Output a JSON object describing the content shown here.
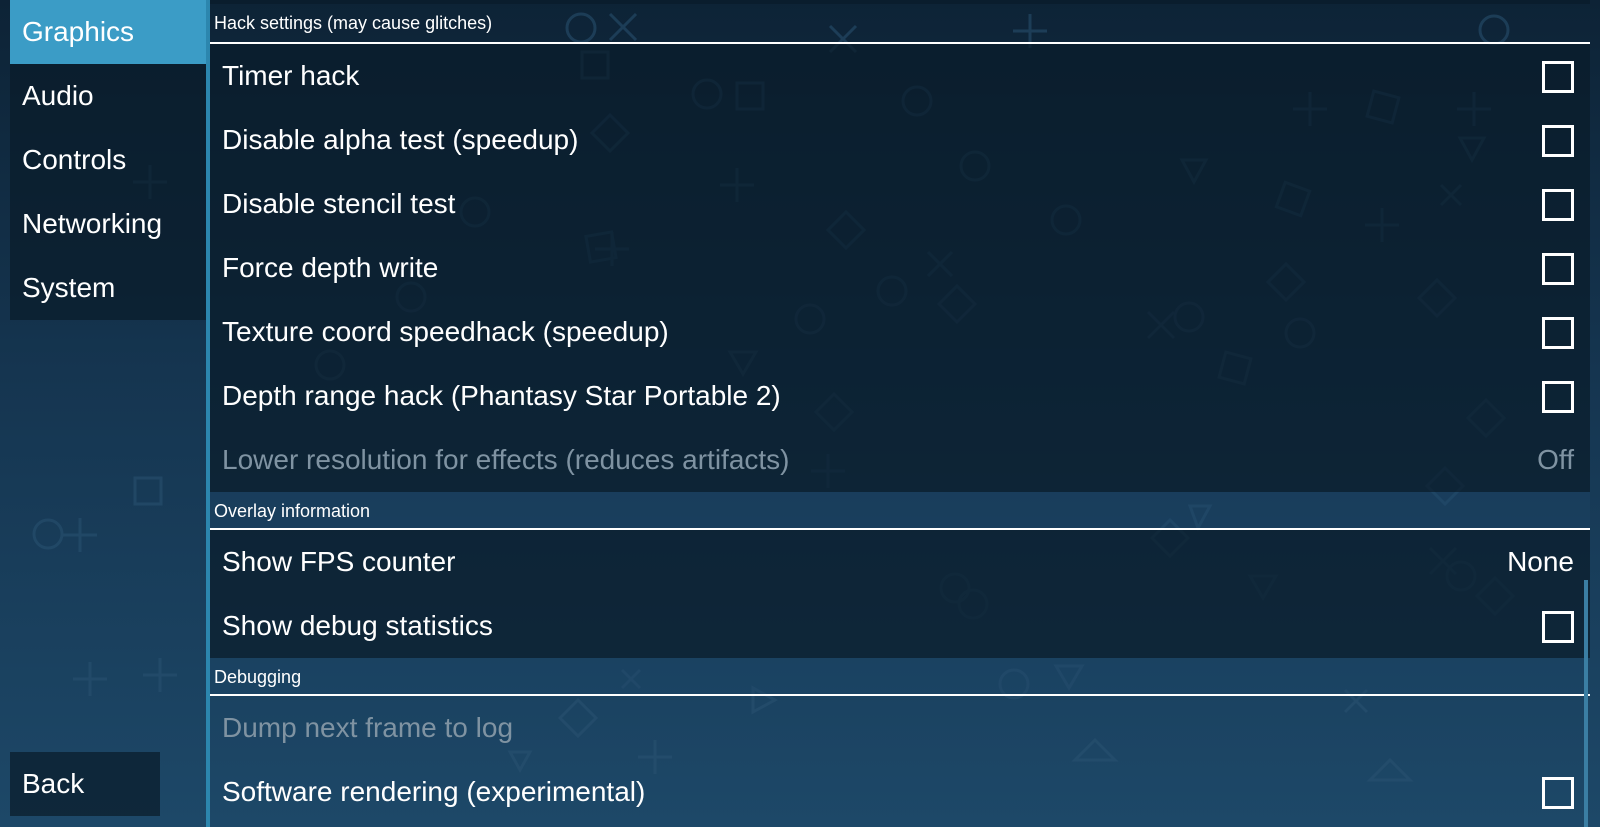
{
  "sidebar": {
    "tabs": [
      {
        "label": "Graphics",
        "active": true
      },
      {
        "label": "Audio",
        "active": false
      },
      {
        "label": "Controls",
        "active": false
      },
      {
        "label": "Networking",
        "active": false
      },
      {
        "label": "System",
        "active": false
      }
    ],
    "back_label": "Back"
  },
  "sections": {
    "hacks": {
      "title": "Hack settings (may cause glitches)",
      "items": [
        {
          "label": "Timer hack",
          "checked": false
        },
        {
          "label": "Disable alpha test (speedup)",
          "checked": false
        },
        {
          "label": "Disable stencil test",
          "checked": false
        },
        {
          "label": "Force depth write",
          "checked": false
        },
        {
          "label": "Texture coord speedhack (speedup)",
          "checked": false
        },
        {
          "label": "Depth range hack (Phantasy Star Portable 2)",
          "checked": false
        },
        {
          "label": "Lower resolution for effects (reduces artifacts)",
          "value": "Off",
          "disabled": true
        }
      ]
    },
    "overlay": {
      "title": "Overlay information",
      "items": [
        {
          "label": "Show FPS counter",
          "value": "None"
        },
        {
          "label": "Show debug statistics",
          "checked": false
        }
      ]
    },
    "debugging": {
      "title": "Debugging",
      "items": [
        {
          "label": "Dump next frame to log",
          "disabled": true
        },
        {
          "label": "Software rendering (experimental)",
          "checked": false
        }
      ]
    }
  },
  "colors": {
    "accent": "#3b9cc6",
    "background_top": "#0d2336",
    "background_bottom": "#1d4868",
    "disabled_text": "#7f93a2"
  }
}
